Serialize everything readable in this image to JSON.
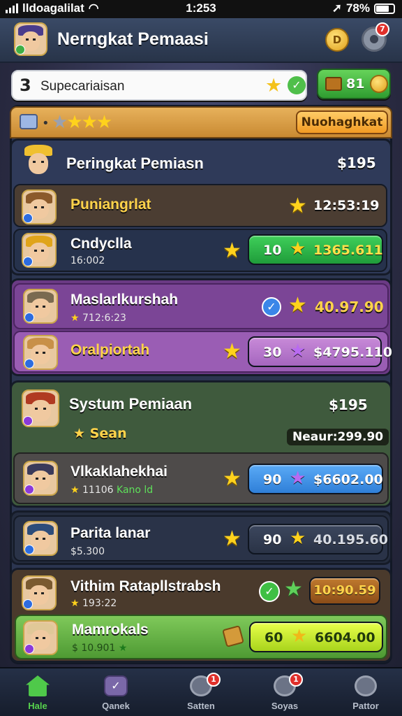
{
  "status_bar": {
    "carrier": "lldoagalilat",
    "time": "1:253",
    "battery": "78%"
  },
  "header": {
    "title": "Nerngkat Pemaasi",
    "coin_badge": "D",
    "notification_count": "7"
  },
  "search": {
    "glyph": "3",
    "placeholder": "Supecariaisan"
  },
  "chest": {
    "value": "81"
  },
  "tabbar": {
    "button_label": "Nuohaghkat",
    "stars_gray": "★",
    "stars_yellow": "★★★"
  },
  "sections": [
    {
      "title": "Peringkat Pemiasn",
      "value": "$195",
      "rows": [
        {
          "name": "Puniangrlat",
          "time": "12:53:19"
        },
        {
          "name": "Cndyclla",
          "sub": "16:002",
          "pill_a": "10",
          "pill_b": "1365.611"
        }
      ]
    },
    {
      "title": "",
      "rows": [
        {
          "name": "Maslarlkurshah",
          "sub": "712:6:23",
          "value": "40.97.90"
        },
        {
          "name": "Oralpiortah",
          "pill_a": "30",
          "pill_b": "$4795.110"
        }
      ]
    },
    {
      "title": "Systum Pemiaan",
      "value": "$195",
      "sub_label": "Sean",
      "nearby": "Neaur:299.90",
      "rows": [
        {
          "name": "Vlkaklahekhai",
          "sub": "11106",
          "sub_green": "Kano ld",
          "pill_a": "90",
          "pill_b": "$6602.00"
        }
      ]
    },
    {
      "rows": [
        {
          "name": "Parita lanar",
          "sub": "$5.300",
          "pill_a": "90",
          "pill_b": "40.195.60"
        }
      ]
    },
    {
      "title": "Vithim Ratapllstrabsh",
      "sub": "193:22",
      "value": "10:90.59",
      "rows": [
        {
          "name": "Mamrokals",
          "sub": "10.901",
          "pill_a": "60",
          "pill_b": "6604.00"
        }
      ]
    }
  ],
  "nav": {
    "items": [
      {
        "label": "Hale",
        "notif": ""
      },
      {
        "label": "Qanek",
        "notif": ""
      },
      {
        "label": "Satten",
        "notif": "1"
      },
      {
        "label": "Soyas",
        "notif": "1"
      },
      {
        "label": "Pattor",
        "notif": ""
      }
    ]
  },
  "colors": {
    "accent_green": "#57d24d",
    "gold": "#ffd21c",
    "notif_red": "#e0302b"
  }
}
